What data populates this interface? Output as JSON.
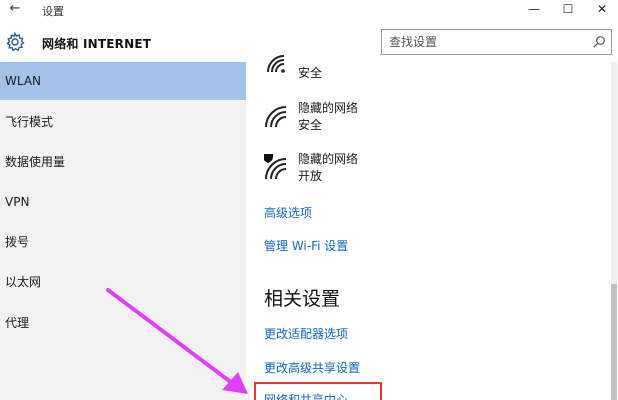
{
  "window": {
    "back_glyph": "←",
    "title": "设置",
    "min_glyph": "—",
    "max_glyph": "☐",
    "close_glyph": "✕"
  },
  "header": {
    "title": "网络和 INTERNET",
    "search_placeholder": "查找设置",
    "icon": "gear-icon"
  },
  "sidebar": {
    "items": [
      {
        "label": "WLAN",
        "active": true
      },
      {
        "label": "飞行模式"
      },
      {
        "label": "数据使用量"
      },
      {
        "label": "VPN"
      },
      {
        "label": "拨号"
      },
      {
        "label": "以太网"
      },
      {
        "label": "代理"
      }
    ]
  },
  "networks": [
    {
      "name": "",
      "status": "安全",
      "icon": "wifi-icon"
    },
    {
      "name": "隐藏的网络",
      "status": "安全",
      "icon": "wifi-icon"
    },
    {
      "name": "隐藏的网络",
      "status": "开放",
      "icon": "wifi-shield-icon"
    }
  ],
  "links": {
    "advanced_options": "高级选项",
    "manage_wifi": "管理 Wi-Fi 设置"
  },
  "related": {
    "title": "相关设置",
    "change_adapter": "更改适配器选项",
    "change_sharing": "更改高级共享设置",
    "network_center": "网络和共享中心"
  },
  "colors": {
    "accent": "#1166c2",
    "active_nav": "#a3c4ea",
    "sidebar_bg": "#f2f2f2",
    "highlight": "#e53935",
    "arrow": "#e040fb"
  }
}
